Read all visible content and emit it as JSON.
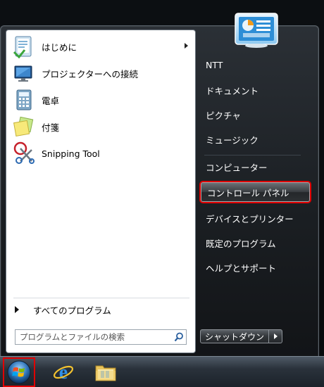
{
  "start_menu": {
    "pinned_programs": [
      {
        "label": "はじめに",
        "icon": "getting-started-icon",
        "has_submenu": true
      },
      {
        "label": "プロジェクターへの接続",
        "icon": "projector-connect-icon",
        "has_submenu": false
      },
      {
        "label": "電卓",
        "icon": "calculator-icon",
        "has_submenu": false
      },
      {
        "label": "付箋",
        "icon": "sticky-notes-icon",
        "has_submenu": false
      },
      {
        "label": "Snipping Tool",
        "icon": "snipping-tool-icon",
        "has_submenu": false
      }
    ],
    "all_programs_label": "すべてのプログラム",
    "search_placeholder": "プログラムとファイルの検索",
    "right_links": [
      {
        "label": "NTT"
      },
      {
        "label": "ドキュメント"
      },
      {
        "label": "ピクチャ"
      },
      {
        "label": "ミュージック"
      },
      {
        "label": "コンピューター"
      },
      {
        "label": "コントロール パネル",
        "highlighted": true
      },
      {
        "label": "デバイスとプリンター"
      },
      {
        "label": "既定のプログラム"
      },
      {
        "label": "ヘルプとサポート"
      }
    ],
    "shutdown_label": "シャットダウン"
  },
  "taskbar": {
    "items": [
      {
        "icon": "windows-start-orb-icon",
        "highlighted": true
      },
      {
        "icon": "internet-explorer-icon"
      },
      {
        "icon": "windows-explorer-folder-icon"
      }
    ]
  },
  "colors": {
    "highlight_border": "#e00000",
    "menu_background": "#1b1f23",
    "left_panel_background": "#ffffff"
  }
}
